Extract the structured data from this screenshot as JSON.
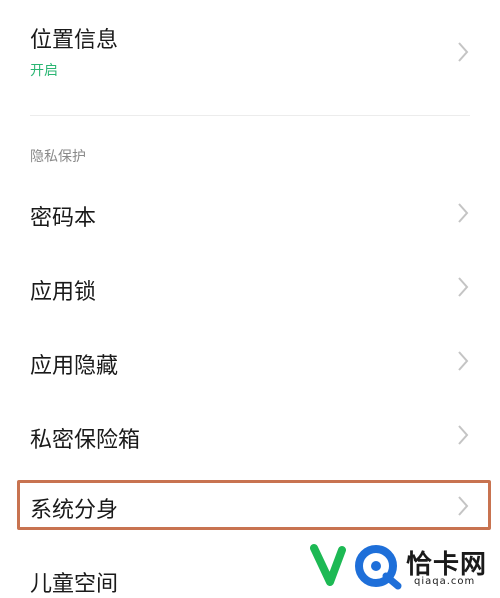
{
  "location": {
    "title": "位置信息",
    "status": "开启",
    "status_color": "#2bb673"
  },
  "privacy_section": {
    "header": "隐私保护",
    "items": [
      {
        "label": "密码本"
      },
      {
        "label": "应用锁"
      },
      {
        "label": "应用隐藏"
      },
      {
        "label": "私密保险箱"
      },
      {
        "label": "系统分身"
      },
      {
        "label": "儿童空间"
      }
    ]
  },
  "highlight": {
    "target": "系统分身",
    "color": "#c87350"
  },
  "watermark": {
    "brand": "恰卡网",
    "url": "qiaqa.com",
    "colors": [
      "#1db954",
      "#1e6fd9"
    ]
  },
  "icons": {
    "chevron": "chevron-right-icon"
  }
}
